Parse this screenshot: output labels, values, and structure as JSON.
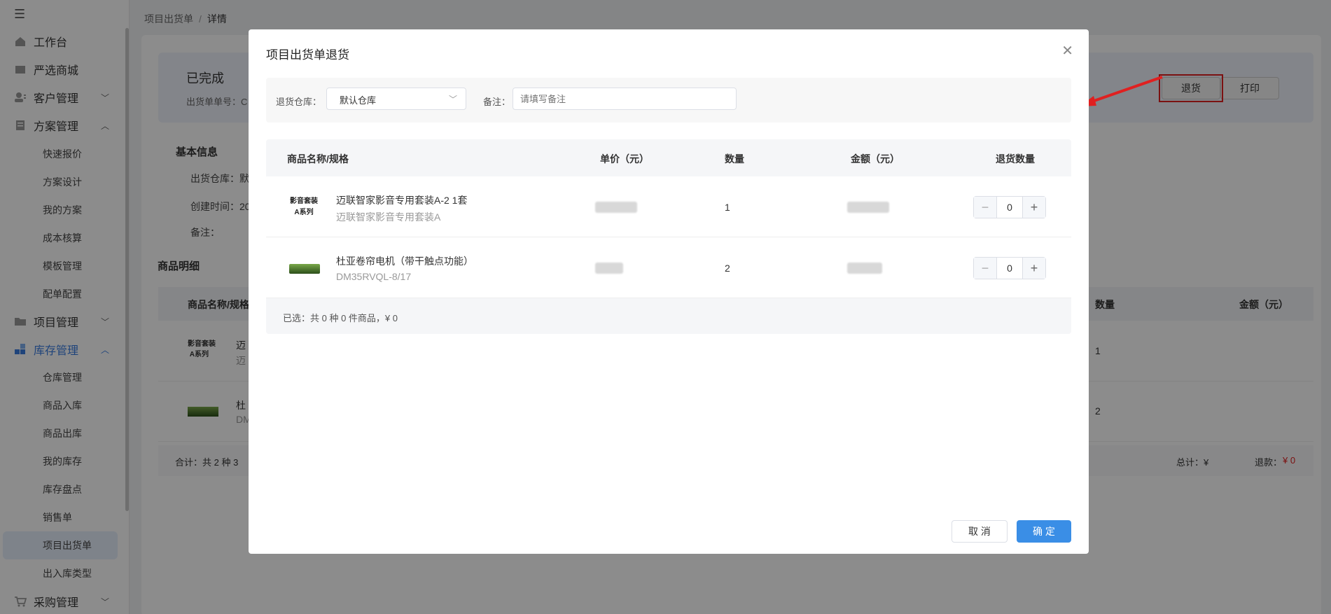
{
  "sidebar": {
    "items": [
      {
        "label": "工作台"
      },
      {
        "label": "严选商城"
      },
      {
        "label": "客户管理"
      },
      {
        "label": "方案管理"
      },
      {
        "label": "项目管理"
      },
      {
        "label": "库存管理"
      },
      {
        "label": "采购管理"
      }
    ],
    "plan_sub": [
      "快速报价",
      "方案设计",
      "我的方案",
      "成本核算",
      "模板管理",
      "配单配置"
    ],
    "stock_sub": [
      "仓库管理",
      "商品入库",
      "商品出库",
      "我的库存",
      "库存盘点",
      "销售单",
      "项目出货单",
      "出入库类型"
    ]
  },
  "breadcrumb": {
    "parent": "项目出货单",
    "separator": "/",
    "current": "详情"
  },
  "detail": {
    "status": "已完成",
    "order_no_label": "出货单单号：C",
    "return_button": "退货",
    "print_button": "打印",
    "basic_info_title": "基本信息",
    "warehouse_line": "出货仓库：默",
    "created_line": "创建时间：20",
    "remark_line": "备注：",
    "goods_title": "商品明细",
    "col_name": "商品名称/规格",
    "col_qty": "数量",
    "col_amount": "金额（元）",
    "row1_name": "迈",
    "row1_spec": "迈",
    "row1_qty": "1",
    "row2_name": "杜",
    "row2_spec": "DM",
    "row2_qty": "2",
    "summary_left": "合计：共 2 种 3",
    "summary_total": "总计：¥",
    "summary_refund_label": "退款：",
    "summary_refund_value": "¥ 0"
  },
  "modal": {
    "title": "项目出货单退货",
    "warehouse_label": "退货仓库：",
    "warehouse_value": "默认仓库",
    "remark_label": "备注：",
    "remark_placeholder": "请填写备注",
    "columns": {
      "name": "商品名称/规格",
      "price": "单价（元）",
      "qty": "数量",
      "amount": "金额（元）",
      "return_qty": "退货数量"
    },
    "rows": [
      {
        "thumb": "影音套装\nA系列",
        "name": "迈联智家影音专用套装A-2 1套",
        "spec": "迈联智家影音专用套装A",
        "qty": "1",
        "return_qty": "0"
      },
      {
        "thumb": "",
        "name": "杜亚卷帘电机（带干触点功能）",
        "spec": "DM35RVQL-8/17",
        "qty": "2",
        "return_qty": "0"
      }
    ],
    "summary": "已选：共 0 种 0 件商品，¥ 0",
    "cancel": "取 消",
    "confirm": "确 定"
  },
  "colors": {
    "accent": "#3a8ee6",
    "highlight": "#e02020"
  }
}
